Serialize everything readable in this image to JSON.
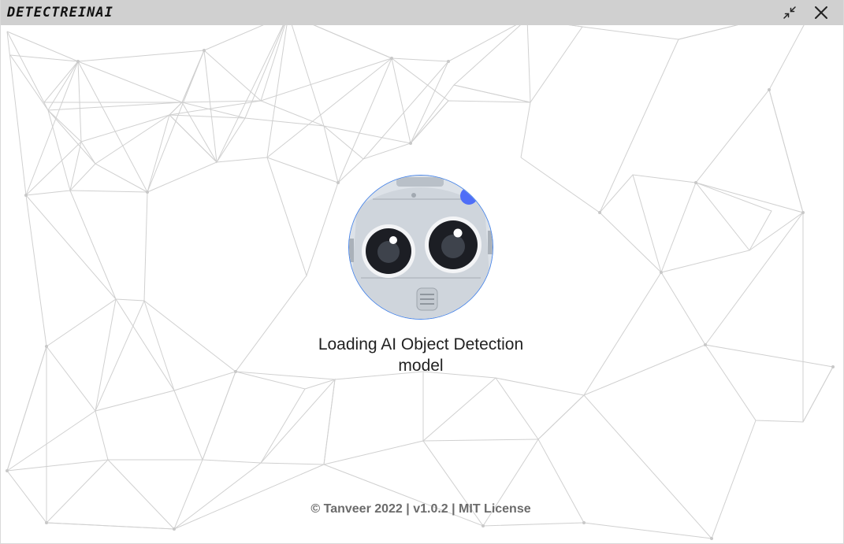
{
  "window": {
    "title": "DETECTREINAI",
    "actions": {
      "minimize_icon": "minimize-arrows-icon",
      "close_icon": "close-icon"
    }
  },
  "main": {
    "avatar_icon": "robot-face-icon",
    "status": "Loading AI Object Detection model",
    "footer": "© Tanveer 2022 | v1.0.2 | MIT License"
  },
  "colors": {
    "titlebar": "#d0d0d0",
    "network_lines": "#cfcfcf",
    "avatar_border": "#4a86e8",
    "robot_accent": "#4f6ef7"
  }
}
